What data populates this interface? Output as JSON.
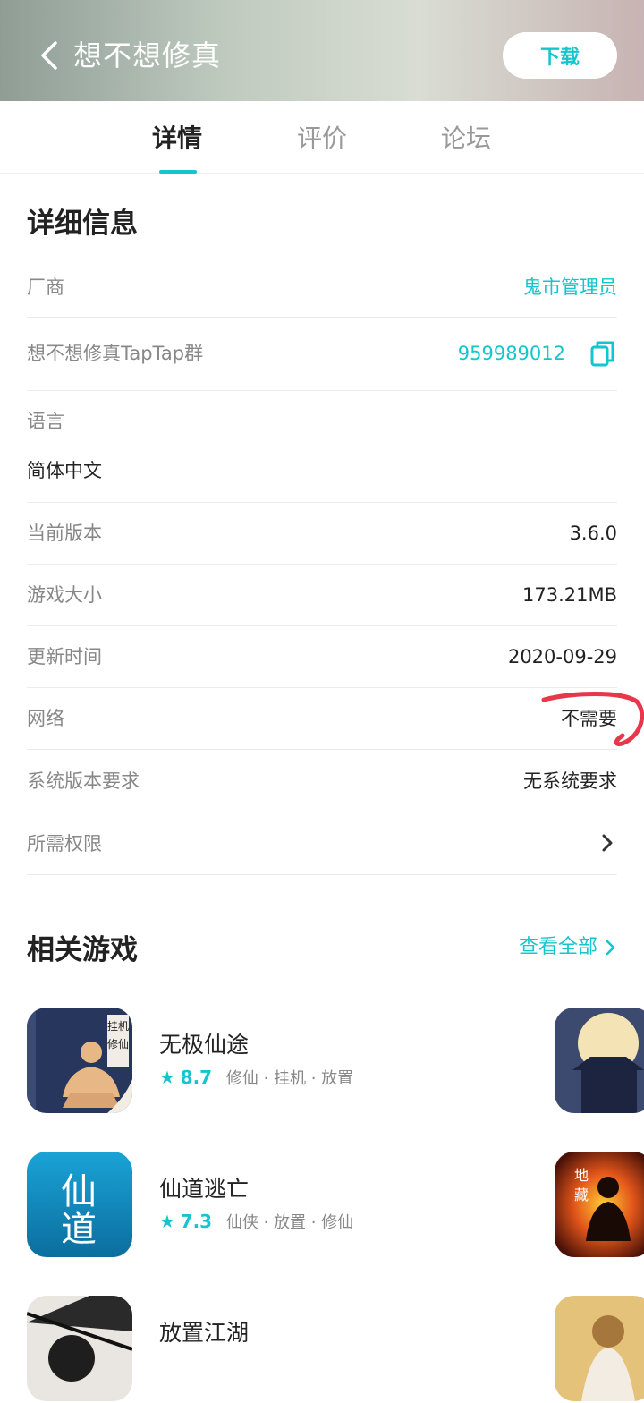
{
  "header": {
    "title": "想不想修真",
    "download_label": "下载"
  },
  "tabs": [
    {
      "label": "详情",
      "active": true
    },
    {
      "label": "评价",
      "active": false
    },
    {
      "label": "论坛",
      "active": false
    }
  ],
  "details": {
    "title": "详细信息",
    "vendor": {
      "label": "厂商",
      "value": "鬼市管理员"
    },
    "group": {
      "label": "想不想修真TapTap群",
      "value": "959989012"
    },
    "language": {
      "label": "语言",
      "value": "简体中文"
    },
    "version": {
      "label": "当前版本",
      "value": "3.6.0"
    },
    "size": {
      "label": "游戏大小",
      "value": "173.21MB"
    },
    "updated": {
      "label": "更新时间",
      "value": "2020-09-29"
    },
    "network": {
      "label": "网络",
      "value": "不需要"
    },
    "os": {
      "label": "系统版本要求",
      "value": "无系统要求"
    },
    "permissions": {
      "label": "所需权限"
    }
  },
  "related": {
    "title": "相关游戏",
    "see_all": "查看全部",
    "games": [
      {
        "name": "无极仙途",
        "score": "8.7",
        "tags": "修仙 · 挂机 · 放置",
        "icon_text": "挂机修仙"
      },
      {
        "name": "仙道逃亡",
        "score": "7.3",
        "tags": "仙侠 · 放置 · 修仙",
        "icon_text": "仙道"
      },
      {
        "name": "放置江湖",
        "score": "",
        "tags": ""
      }
    ]
  },
  "side_icons": {
    "second_text": "地藏"
  },
  "colors": {
    "accent": "#15c5ce",
    "annotation": "#e8374a"
  }
}
